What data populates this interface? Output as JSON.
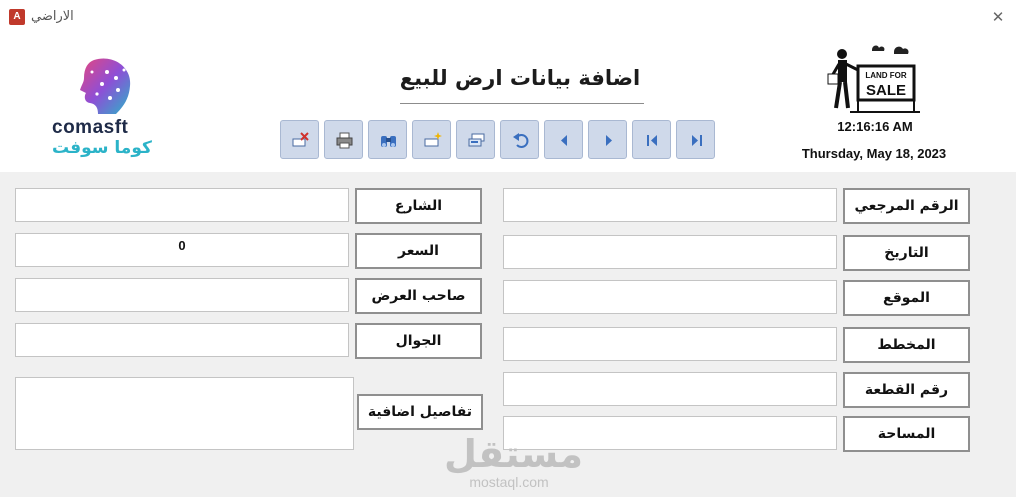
{
  "window": {
    "title": "الاراضي",
    "app_icon_letter": "A",
    "close_glyph": "✕"
  },
  "header": {
    "form_title": "اضافة بيانات ارض للبيع",
    "logo": {
      "brand_en": "comasft",
      "brand_ar": "كوما سوفت"
    },
    "sign_text": {
      "line1": "LAND FOR",
      "line2": "SALE"
    },
    "clock": {
      "time": "12:16:16 AM",
      "date": "Thursday, May 18, 2023"
    }
  },
  "toolbar": {
    "buttons": [
      {
        "name": "delete-record",
        "icon": "delete-icon"
      },
      {
        "name": "print",
        "icon": "printer-icon"
      },
      {
        "name": "find",
        "icon": "binoculars-icon"
      },
      {
        "name": "new-record",
        "icon": "new-record-icon"
      },
      {
        "name": "save",
        "icon": "save-icon"
      },
      {
        "name": "undo",
        "icon": "undo-icon"
      },
      {
        "name": "previous",
        "icon": "triangle-left-icon"
      },
      {
        "name": "next",
        "icon": "triangle-right-icon"
      },
      {
        "name": "first",
        "icon": "first-record-icon"
      },
      {
        "name": "last",
        "icon": "last-record-icon"
      }
    ]
  },
  "form": {
    "right": {
      "reference": {
        "label": "الرقم المرجعي",
        "value": ""
      },
      "date": {
        "label": "التاريخ",
        "value": ""
      },
      "location": {
        "label": "الموقع",
        "value": ""
      },
      "plan": {
        "label": "المخطط",
        "value": ""
      },
      "plot_number": {
        "label": "رقم القطعة",
        "value": ""
      },
      "area": {
        "label": "المساحة",
        "value": ""
      }
    },
    "left": {
      "street": {
        "label": "الشارع",
        "value": ""
      },
      "price": {
        "label": "السعر",
        "value": "0"
      },
      "owner": {
        "label": "صاحب العرض",
        "value": ""
      },
      "mobile": {
        "label": "الجوال",
        "value": ""
      },
      "details": {
        "label": "تفاصيل اضافية",
        "value": ""
      }
    }
  },
  "watermark": {
    "ar": "مستقل",
    "en": "mostaql.com"
  },
  "colors": {
    "button_bg": "#cfd9ea",
    "icon_blue": "#3a6fbf",
    "logo_cyan": "#2bb3c8",
    "logo_navy": "#1f2b48",
    "form_bg": "#f0f0f0"
  }
}
